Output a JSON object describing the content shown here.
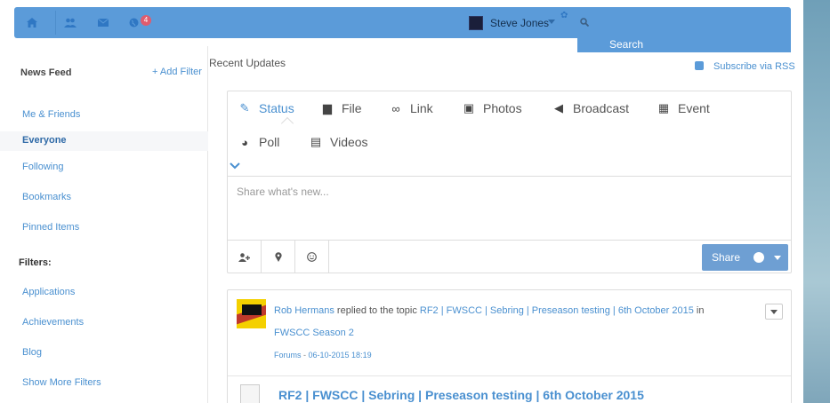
{
  "colors": {
    "topbar": "#5b9bd9",
    "link": "#4a90d0",
    "badge": "#e05c6e",
    "share_button": "#6e9fd3"
  },
  "topbar": {
    "icons": [
      "home-icon",
      "users-icon",
      "envelope-icon",
      "globe-icon"
    ],
    "notification_count": "4",
    "user_name": "Steve Jones",
    "search_label": "Search"
  },
  "sidebar": {
    "heading": "News Feed",
    "add_filter": "+ Add Filter",
    "items": [
      {
        "label": "Me & Friends"
      },
      {
        "label": "Everyone",
        "active": true
      },
      {
        "label": "Following"
      },
      {
        "label": "Bookmarks"
      },
      {
        "label": "Pinned Items"
      }
    ],
    "filters_heading": "Filters:",
    "filters": [
      {
        "label": "Applications"
      },
      {
        "label": "Achievements"
      },
      {
        "label": "Blog"
      },
      {
        "label": "Show More Filters"
      }
    ]
  },
  "main": {
    "title": "Recent Updates",
    "rss_label": "Subscribe via RSS",
    "composer": {
      "tabs": [
        {
          "label": "Status",
          "icon": "pencil-icon",
          "active": true
        },
        {
          "label": "File",
          "icon": "folder-icon"
        },
        {
          "label": "Link",
          "icon": "link-icon"
        },
        {
          "label": "Photos",
          "icon": "image-icon"
        },
        {
          "label": "Broadcast",
          "icon": "bullhorn-icon"
        },
        {
          "label": "Event",
          "icon": "calendar-icon"
        },
        {
          "label": "Poll",
          "icon": "pie-chart-icon"
        },
        {
          "label": "Videos",
          "icon": "film-icon"
        }
      ],
      "placeholder": "Share what's new...",
      "tools": [
        "tag-user-icon",
        "location-icon",
        "smiley-icon"
      ],
      "share_label": "Share"
    },
    "activity": {
      "actor": "Rob Hermans",
      "action": "replied to the topic",
      "topic": "RF2 | FWSCC | Sebring | Preseason testing | 6th October 2015",
      "preposition": "in",
      "group": "FWSCC Season 2",
      "source": "Forums",
      "separator": " - ",
      "timestamp": "06-10-2015 18:19",
      "title": "RF2 | FWSCC | Sebring | Preseason testing | 6th October 2015"
    }
  }
}
